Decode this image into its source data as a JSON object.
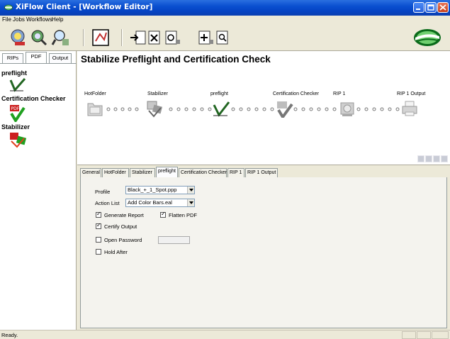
{
  "window": {
    "title": "XiFlow Client - [Workflow Editor]",
    "controls": [
      "minimize",
      "maximize",
      "close"
    ]
  },
  "menubar": {
    "items": [
      {
        "label": "File"
      },
      {
        "label": "Jobs"
      },
      {
        "label": "Workflows"
      },
      {
        "label": "Help"
      }
    ]
  },
  "toolbar": {
    "buttons": [
      "rip-icon",
      "preflight-icon",
      "search-icon",
      "workflow-editor-icon",
      "import-icon",
      "delete-icon",
      "refresh-icon",
      "add-icon",
      "find-icon"
    ],
    "logo": "globe-logo-icon"
  },
  "left_panel": {
    "tabs": [
      {
        "label": "RIPs",
        "active": false
      },
      {
        "label": "PDF",
        "active": true
      },
      {
        "label": "Output",
        "active": false
      }
    ],
    "items": [
      {
        "label": "preflight",
        "icon": "checkmark-icon"
      },
      {
        "label": "Certification Checker",
        "icon": "pdf-check-icon"
      },
      {
        "label": "Stabilizer",
        "icon": "stabilizer-icon"
      }
    ]
  },
  "workflow": {
    "title": "Stabilize Preflight and Certification Check",
    "nodes": [
      {
        "label": "HotFolder",
        "icon": "folder-icon"
      },
      {
        "label": "Stabilizer",
        "icon": "stabilizer-icon"
      },
      {
        "label": "preflight",
        "icon": "checkmark-icon"
      },
      {
        "label": "Certification Checker",
        "icon": "pdf-check-icon"
      },
      {
        "label": "RIP 1",
        "icon": "rip-printer-icon"
      },
      {
        "label": "RIP 1 Output",
        "icon": "printer-icon"
      }
    ]
  },
  "properties": {
    "tabs": [
      {
        "label": "General",
        "active": false
      },
      {
        "label": "HotFolder",
        "active": false
      },
      {
        "label": "Stabilizer",
        "active": false
      },
      {
        "label": "preflight",
        "active": true
      },
      {
        "label": "Certification Checker",
        "active": false
      },
      {
        "label": "RIP 1",
        "active": false
      },
      {
        "label": "RIP 1 Output",
        "active": false
      }
    ],
    "profile_label": "Profile",
    "profile_value": "Black_+_1_Spot.ppp",
    "action_list_label": "Action List",
    "action_list_value": "Add Color Bars.eal",
    "generate_report_label": "Generate Report",
    "generate_report_checked": true,
    "flatten_pdf_label": "Flatten PDF",
    "flatten_pdf_checked": true,
    "certify_output_label": "Certify Output",
    "certify_output_checked": true,
    "open_password_label": "Open Password",
    "open_password_checked": false,
    "open_password_value": "",
    "hold_after_label": "Hold After",
    "hold_after_checked": false
  },
  "status": {
    "text": "Ready."
  }
}
